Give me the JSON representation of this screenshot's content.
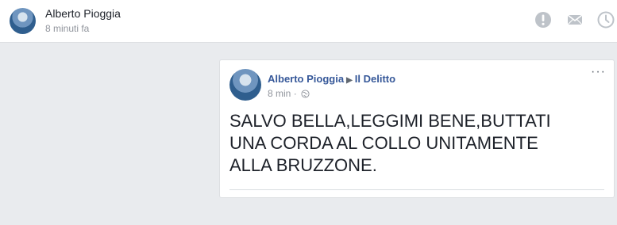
{
  "notification": {
    "author": "Alberto Pioggia",
    "time": "8 minuti fa",
    "icons": [
      "alert-icon",
      "mail-icon",
      "clock-icon"
    ]
  },
  "post": {
    "author": "Alberto Pioggia",
    "group": "Il Delitto",
    "time": "8 min",
    "separator": "·",
    "privacy_icon": "globe-icon",
    "more": "···",
    "text": "SALVO BELLA,LEGGIMI BENE,BUTTATI\nUNA CORDA AL COLLO UNITAMENTE\nALLA BRUZZONE."
  },
  "colors": {
    "link": "#365899",
    "background": "#e9ebee",
    "muted": "#90949c"
  }
}
